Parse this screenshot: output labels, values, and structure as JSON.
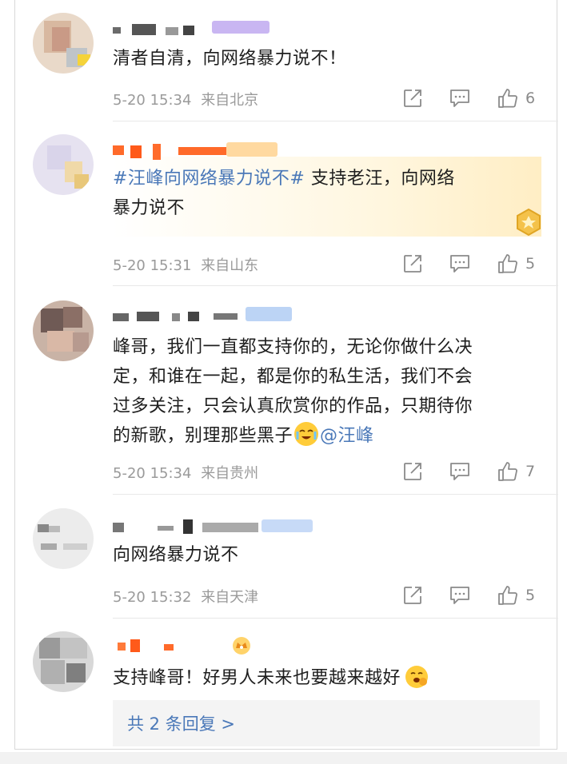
{
  "comments": [
    {
      "text": "清者自清，向网络暴力说不！",
      "time": "5-20 15:34",
      "location": "来自北京",
      "likes": "6"
    },
    {
      "topic": "#汪峰向网络暴力说不#",
      "text_line1": " 支持老汪，向网络",
      "text_line2": "暴力说不",
      "time": "5-20 15:31",
      "location": "来自山东",
      "likes": "5"
    },
    {
      "text_line1": "峰哥，我们一直都支持你的，无论你做什么决",
      "text_line2": "定，和谁在一起，都是你的私生活，我们不会",
      "text_line3": "过多关注，只会认真欣赏你的作品，只期待你",
      "text_line4": "的新歌，别理那些黑子",
      "mention": "@汪峰",
      "time": "5-20 15:34",
      "location": "来自贵州",
      "likes": "7"
    },
    {
      "text": "向网络暴力说不",
      "time": "5-20 15:32",
      "location": "来自天津",
      "likes": "5"
    },
    {
      "text": "支持峰哥！好男人未来也要越来越好",
      "replies": "共 2 条回复 >"
    }
  ],
  "icons": {
    "repost": "share-icon",
    "comment": "comment-icon",
    "like": "thumbs-up-icon"
  },
  "colors": {
    "link": "#4a78b8",
    "meta": "#9a9a9a"
  }
}
